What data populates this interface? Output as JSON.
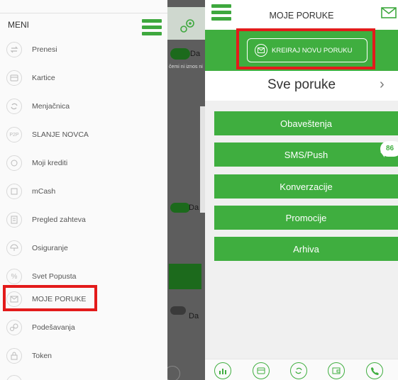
{
  "left": {
    "menu_title": "MENI",
    "items": [
      {
        "label": "Prenesi",
        "icon": "transfer-icon"
      },
      {
        "label": "Kartice",
        "icon": "card-icon"
      },
      {
        "label": "Menjačnica",
        "icon": "exchange-icon"
      },
      {
        "label": "SLANJE NOVCA",
        "icon": "p2p-icon"
      },
      {
        "label": "Moji krediti",
        "icon": "loan-icon"
      },
      {
        "label": "mCash",
        "icon": "mcash-icon"
      },
      {
        "label": "Pregled zahteva",
        "icon": "requests-icon"
      },
      {
        "label": "Osiguranje",
        "icon": "umbrella-icon"
      },
      {
        "label": "Svet Popusta",
        "icon": "percent-icon"
      },
      {
        "label": "MOJE PORUKE",
        "icon": "message-icon"
      },
      {
        "label": "Podešavanja",
        "icon": "gear-icon"
      },
      {
        "label": "Token",
        "icon": "lock-icon"
      }
    ],
    "bg_da": "Da",
    "bg_small_text": "čemi ni iznos ni"
  },
  "right": {
    "title": "MOJE PORUKE",
    "new_message_button": "KREIRAJ NOVU PORUKU",
    "all_messages": "Sve poruke",
    "buttons": [
      "Obaveštenja",
      "SMS/Push",
      "Konverzacije",
      "Promocije",
      "Arhiva"
    ],
    "sms_badge": "86",
    "bottom_nav_icons": [
      "chart-icon",
      "card-icon",
      "exchange-icon",
      "wallet-icon",
      "phone-icon"
    ]
  },
  "colors": {
    "accent_green": "#3fae3f",
    "highlight_red": "#e31b1b"
  }
}
